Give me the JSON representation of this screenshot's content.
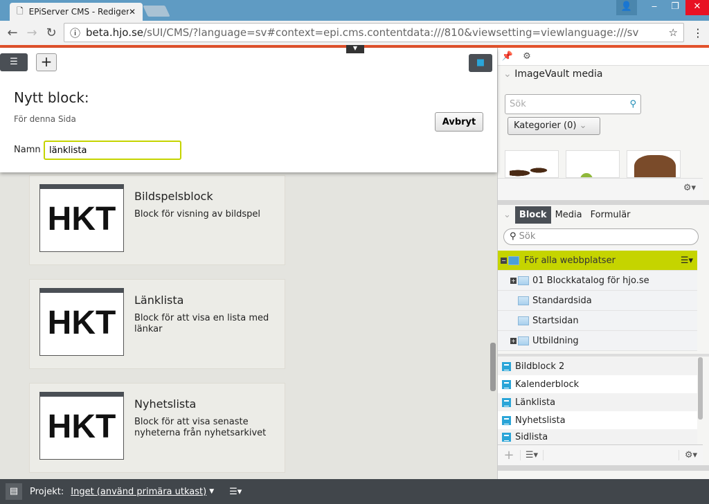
{
  "browser": {
    "tab_title": "EPiServer CMS - Redigera",
    "url_host": "beta.hjo.se",
    "url_path": "/sUI/CMS/?language=sv#context=epi.cms.contentdata:///810&viewsetting=viewlanguage:///sv"
  },
  "dialog": {
    "title": "Nytt block:",
    "subtitle": "För denna Sida",
    "cancel_label": "Avbryt",
    "name_label": "Namn",
    "name_value": "länklista"
  },
  "blocks": [
    {
      "thumb": "HKT",
      "title": "Bildspelsblock",
      "desc": "Block för visning av bildspel"
    },
    {
      "thumb": "HKT",
      "title": "Länklista",
      "desc": "Block för att visa en lista med länkar"
    },
    {
      "thumb": "HKT",
      "title": "Nyhetslista",
      "desc": "Block för att visa senaste nyheterna från nyhetsarkivet"
    }
  ],
  "imagevault": {
    "title": "ImageVault media",
    "search_placeholder": "Sök",
    "category_label": "Kategorier (0)"
  },
  "assets": {
    "tabs": [
      "Block",
      "Media",
      "Formulär"
    ],
    "active_tab": "Block",
    "search_placeholder": "Sök",
    "tree": [
      {
        "label": "För alla webbplatser",
        "selected": true
      },
      {
        "label": "01 Blockkatalog för hjo.se",
        "expand": true
      },
      {
        "label": "Standardsida"
      },
      {
        "label": "Startsidan"
      },
      {
        "label": "Utbildning",
        "expand": true
      }
    ],
    "list": [
      "Bildblock 2",
      "Kalenderblock",
      "Länklista",
      "Nyhetslista",
      "Sidlista"
    ]
  },
  "bottom": {
    "project_label": "Projekt:",
    "project_value": "Inget (använd primära utkast)"
  },
  "colors": {
    "accent": "#e2522c",
    "selected": "#c5d400",
    "icon_blue": "#2aa5d8"
  }
}
